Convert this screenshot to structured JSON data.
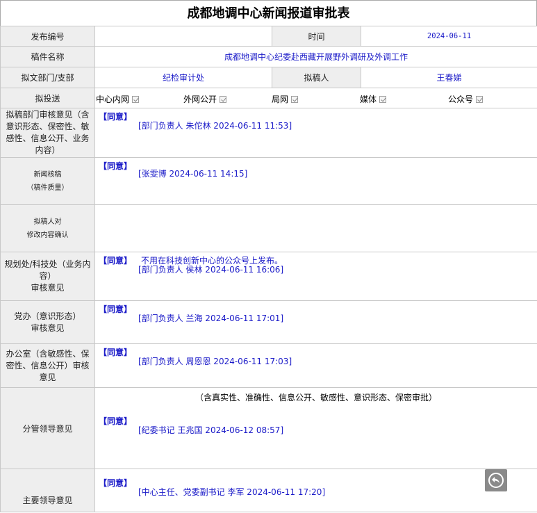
{
  "title": "成都地调中心新闻报道审批表",
  "rows": {
    "publish_no_label": "发布编号",
    "publish_no_value": "",
    "time_label": "时间",
    "time_value": "2024-06-11",
    "manuscript_label": "稿件名称",
    "manuscript_value": "成都地调中心纪委赴西藏开展野外调研及外调工作",
    "dept_label": "拟文部门/支部",
    "dept_value": "纪检审计处",
    "drafter_label": "拟稿人",
    "drafter_value": "王春娣",
    "send_label": "拟投送",
    "send_options": [
      "中心内网",
      "外网公开",
      "局网",
      "媒体",
      "公众号"
    ]
  },
  "opinions": {
    "dept_review_label": "拟稿部门审核意见（含意识形态、保密性、敏感性、信息公开、业务内容）",
    "dept_review_agree": "【同意】",
    "dept_review_sign": "[部门负责人  朱佗林  2024-06-11 11:53]",
    "news_review_label_1": "新闻核稿",
    "news_review_label_2": "（稿件质量）",
    "news_review_agree": "【同意】",
    "news_review_sign": "[张雯博  2024-06-11 14:15]",
    "drafter_confirm_label_1": "拟稿人对",
    "drafter_confirm_label_2": "修改内容确认",
    "planning_label_1": "规划处/科技处（业务内容）",
    "planning_label_2": "审核意见",
    "planning_agree": "【同意】",
    "planning_note": "不用在科技创新中心的公众号上发布。",
    "planning_sign": "[部门负责人  侯林  2024-06-11 16:06]",
    "party_label_1": "党办（意识形态）",
    "party_label_2": "审核意见",
    "party_agree": "【同意】",
    "party_sign": "[部门负责人  兰海  2024-06-11 17:01]",
    "office_label": "办公室（含敏感性、保密性、信息公开）审核意见",
    "office_agree": "【同意】",
    "office_sign": "[部门负责人  周恩恩  2024-06-11 17:03]",
    "leader_label": "分管领导意见",
    "leader_scope": "（含真实性、准确性、信息公开、敏感性、意识形态、保密审批）",
    "leader_agree": "【同意】",
    "leader_sign": "[纪委书记  王兆国  2024-06-12 08:57]",
    "main_leader_label": "主要领导意见",
    "main_leader_agree": "【同意】",
    "main_leader_sign": "[中心主任、党委副书记  李军  2024-06-11 17:20]"
  }
}
